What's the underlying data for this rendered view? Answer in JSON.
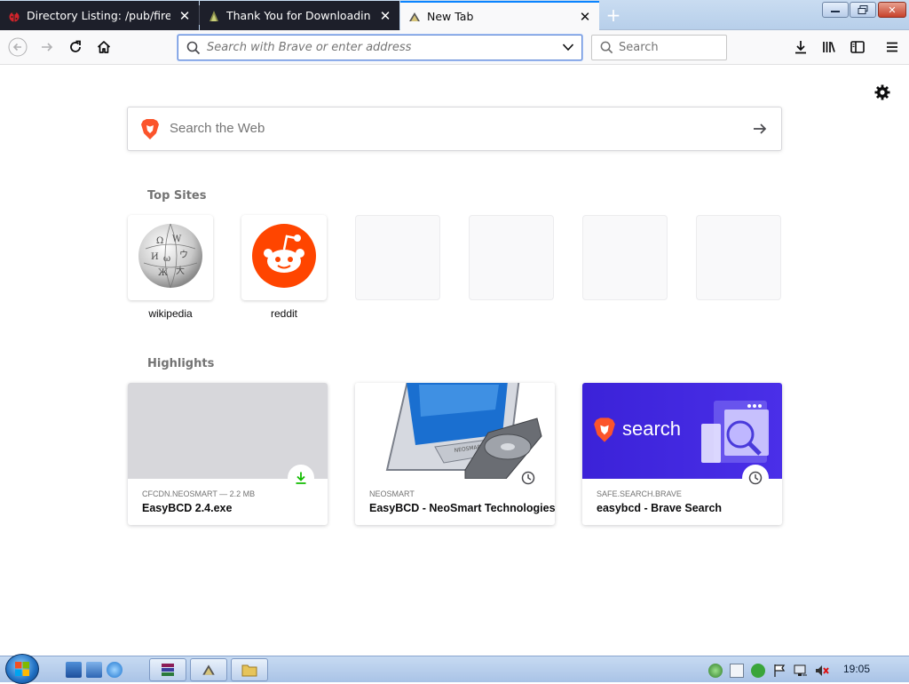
{
  "tabs": [
    {
      "title": "Directory Listing: /pub/firefox/",
      "active": false
    },
    {
      "title": "Thank You for Downloading EasyBCD",
      "active": false
    },
    {
      "title": "New Tab",
      "active": true
    }
  ],
  "toolbar": {
    "url_placeholder": "Search with Brave or enter address",
    "search_placeholder": "Search"
  },
  "newtab": {
    "search_placeholder": "Search the Web",
    "top_sites_heading": "Top Sites",
    "highlights_heading": "Highlights",
    "top_sites": [
      {
        "label": "wikipedia",
        "icon": "wikipedia-globe-icon"
      },
      {
        "label": "reddit",
        "icon": "reddit-icon"
      }
    ],
    "highlights": [
      {
        "source": "CFCDN.NEOSMART — 2.2 MB",
        "title": "EasyBCD 2.4.exe",
        "context_icon": "download-icon"
      },
      {
        "source": "NEOSMART",
        "title": "EasyBCD - NeoSmart Technologies",
        "context_icon": "clock-icon"
      },
      {
        "source": "SAFE.SEARCH.BRAVE",
        "title": "easybcd - Brave Search",
        "context_icon": "clock-icon",
        "thumb_text": "search"
      }
    ]
  },
  "taskbar": {
    "clock": "19:05"
  },
  "colors": {
    "accent": "#0a84ff",
    "reddit": "#ff4500",
    "brave": "#fb542b",
    "download": "#12bc00",
    "brave_search_bg": "#3b22d8"
  }
}
